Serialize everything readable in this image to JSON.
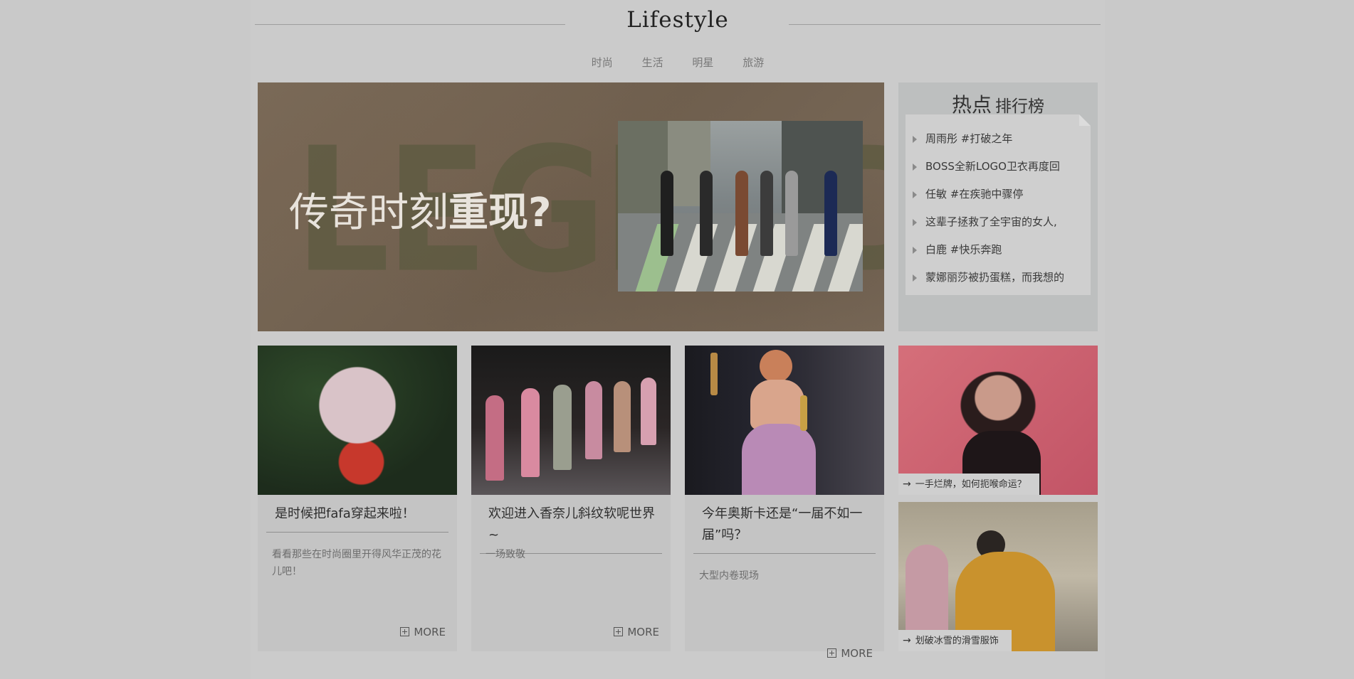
{
  "site": {
    "title": "Lifestyle"
  },
  "nav": {
    "items": [
      "时尚",
      "生活",
      "明星",
      "旅游"
    ]
  },
  "hero": {
    "background_word": "LEGEND",
    "caption_part1": "传奇时刻",
    "caption_part2": "重现?"
  },
  "hot": {
    "title_big": "热点",
    "title_small": "排行榜",
    "items": [
      "周雨彤 #打破之年",
      "BOSS全新LOGO卫衣再度回",
      "任敏 #在疾驰中骤停",
      "这辈子拯救了全宇宙的女人,",
      "白鹿 #快乐奔跑",
      "蒙娜丽莎被扔蛋糕，而我想的"
    ]
  },
  "cards": [
    {
      "title": "是时候把fafa穿起来啦！",
      "desc": "看看那些在时尚圈里开得风华正茂的花儿吧！",
      "more": "MORE"
    },
    {
      "title": "欢迎进入香奈儿斜纹软呢世界~",
      "desc": "一场致敬",
      "more": "MORE"
    },
    {
      "title": "今年奥斯卡还是“一届不如一届”吗？",
      "desc": "大型内卷现场",
      "more": "MORE"
    }
  ],
  "side": [
    {
      "caption": "一手烂牌，如何扼喉命运？"
    },
    {
      "caption": "划破冰雪的滑雪服饰"
    }
  ],
  "icons": {
    "arrow": "arrow-right-icon",
    "plus": "plus-square-icon",
    "bullet": "triangle-bullet-icon"
  },
  "colors": {
    "page_bg": "#c9c9c9",
    "hot_bg": "#bdbfbf",
    "hero_text": "#e8e3dc"
  }
}
